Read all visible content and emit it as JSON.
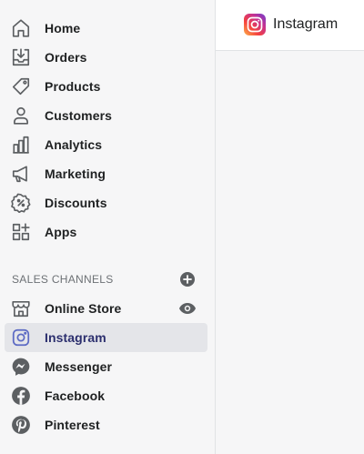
{
  "sidebar": {
    "items": [
      {
        "label": "Home",
        "icon": "home-icon"
      },
      {
        "label": "Orders",
        "icon": "orders-icon"
      },
      {
        "label": "Products",
        "icon": "tag-icon"
      },
      {
        "label": "Customers",
        "icon": "person-icon"
      },
      {
        "label": "Analytics",
        "icon": "bar-chart-icon"
      },
      {
        "label": "Marketing",
        "icon": "megaphone-icon"
      },
      {
        "label": "Discounts",
        "icon": "discount-icon"
      },
      {
        "label": "Apps",
        "icon": "apps-icon"
      }
    ],
    "sales_channels_header": "SALES CHANNELS",
    "channels": [
      {
        "label": "Online Store",
        "icon": "store-icon"
      },
      {
        "label": "Instagram",
        "icon": "instagram-icon",
        "active": true
      },
      {
        "label": "Messenger",
        "icon": "messenger-icon"
      },
      {
        "label": "Facebook",
        "icon": "facebook-icon"
      },
      {
        "label": "Pinterest",
        "icon": "pinterest-icon"
      }
    ]
  },
  "main": {
    "title": "Instagram"
  },
  "colors": {
    "icon": "#5c5f62",
    "active_bg": "#e4e5e9",
    "active_text": "#2c2f6e",
    "active_icon": "#5c6ac4",
    "text": "#202223",
    "muted": "#6d7175"
  }
}
